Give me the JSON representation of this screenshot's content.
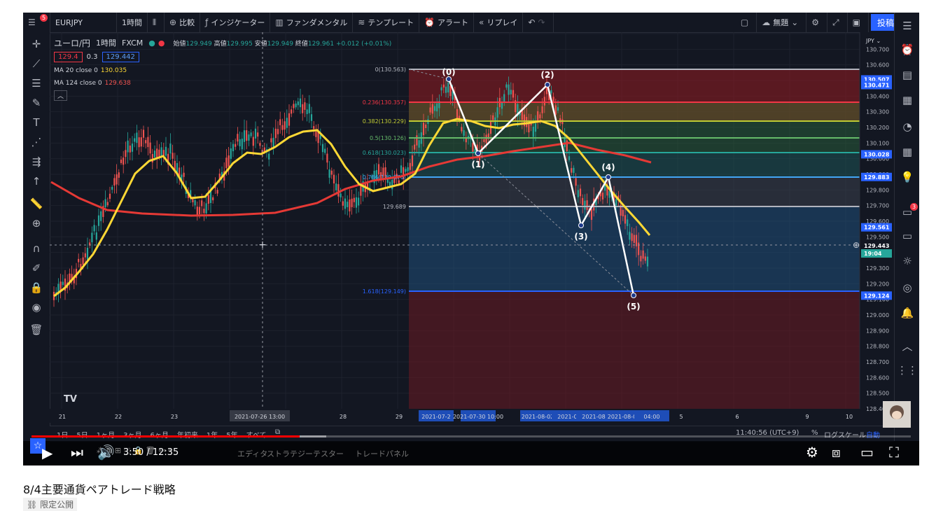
{
  "toolbar": {
    "symbol": "EURJPY",
    "interval": "1時間",
    "compare": "比較",
    "indicators": "インジケーター",
    "fundamentals": "ファンダメンタル",
    "templates": "テンプレート",
    "alert": "アラート",
    "replay": "リプレイ",
    "layout_name": "無題",
    "post_button": "投稿",
    "menu_badge": "5"
  },
  "legend": {
    "title": "ユーロ/円",
    "interval": "1時間",
    "exchange": "FXCM",
    "bid_box": "129.4",
    "spread": "0.3",
    "ask_box": "129.442",
    "ohlc_label_open": "始値",
    "open": "129.949",
    "ohlc_label_high": "高値",
    "high": "129.995",
    "ohlc_label_low": "安値",
    "low": "129.949",
    "ohlc_label_close": "終値",
    "close": "129.961",
    "change": "+0.012 (+0.01%)",
    "ma20_label": "MA 20 close 0",
    "ma20_value": "130.035",
    "ma124_label": "MA 124 close 0",
    "ma124_value": "129.638"
  },
  "price_axis": {
    "currency": "JPY",
    "ticks": [
      "130.800",
      "130.700",
      "130.600",
      "130.500",
      "130.400",
      "130.300",
      "130.200",
      "130.100",
      "130.000",
      "129.900",
      "129.800",
      "129.700",
      "129.600",
      "129.500",
      "129.400",
      "129.300",
      "129.200",
      "129.100",
      "129.000",
      "128.900",
      "128.800",
      "128.700",
      "128.600",
      "128.500",
      "128.400"
    ],
    "labels": [
      {
        "text": "130.507",
        "color": "#2962ff"
      },
      {
        "text": "130.471",
        "color": "#2962ff"
      },
      {
        "text": "130.028",
        "color": "#2962ff"
      },
      {
        "text": "129.883",
        "color": "#2962ff"
      },
      {
        "text": "129.561",
        "color": "#2962ff"
      },
      {
        "text": "129.443",
        "color": "#131722"
      },
      {
        "text": "19:04",
        "color": "#26a69a"
      },
      {
        "text": "129.124",
        "color": "#2962ff"
      }
    ]
  },
  "time_axis": {
    "ticks": [
      "21",
      "22",
      "23",
      "2021-07-26  13:00",
      "28",
      "29",
      "2021-07-2",
      "2021-07-30  10:00",
      "2021-08-02",
      "2021-08",
      "2021-08",
      "2021-08-04",
      "04:00",
      "5",
      "6",
      "9",
      "10"
    ]
  },
  "fib": [
    {
      "ratio": "0(130.563)",
      "color": "#b2b5be"
    },
    {
      "ratio": "0.236(130.357)",
      "color": "#f23645"
    },
    {
      "ratio": "0.382(130.229)",
      "color": "#c0ca33"
    },
    {
      "ratio": "0.5(130.126)",
      "color": "#66bb6a"
    },
    {
      "ratio": "0.618(130.023)",
      "color": "#26a69a"
    },
    {
      "ratio": "0.786(129.876)",
      "color": "#42a5f5"
    },
    {
      "ratio": "129.689",
      "color": "#b2b5be"
    },
    {
      "ratio": "1.618(129.149)",
      "color": "#2962ff"
    }
  ],
  "waves": [
    "(0)",
    "(1)",
    "(2)",
    "(3)",
    "(4)",
    "(5)"
  ],
  "tv_bottom": {
    "ranges": [
      "1日",
      "5日",
      "1ヶ月",
      "3ヶ月",
      "6ヶ月",
      "年初来",
      "1年",
      "5年",
      "すべて"
    ],
    "clock": "11:40:56 (UTC+9)",
    "percent": "%",
    "log": "ログスケール",
    "auto": "自動"
  },
  "tv_panels": {
    "strategy": "ストラテジーテスター",
    "trade": "トレードパネル",
    "editor": "エディタ"
  },
  "player": {
    "time": "3:50 / 12:35",
    "progress": 0.305,
    "buffered": 0.335
  },
  "video": {
    "title": "8/4主要通貨ペアトレード戦略",
    "visibility": "限定公開"
  },
  "right_badge": "3"
}
